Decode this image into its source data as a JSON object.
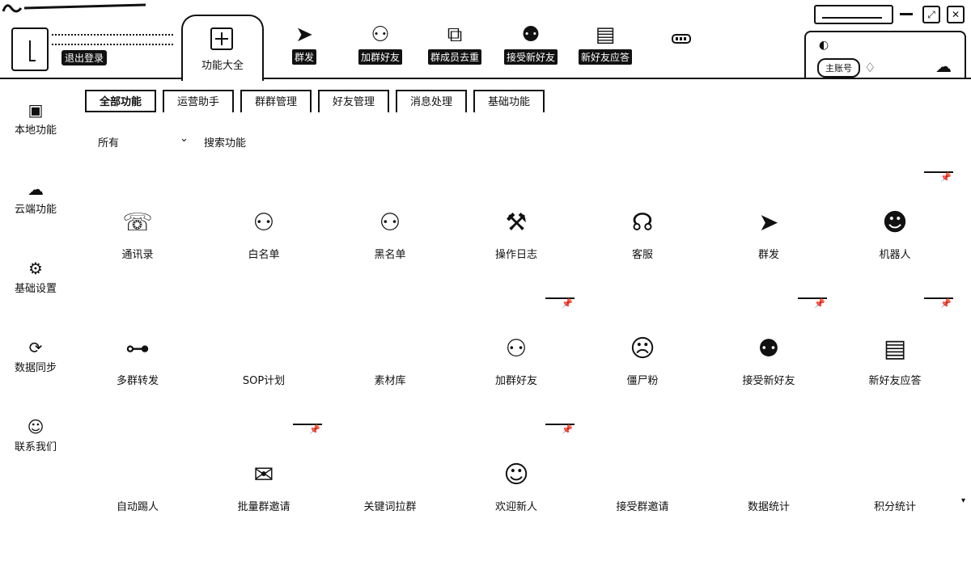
{
  "header": {
    "logout_label": "退出登录",
    "active_tab": {
      "label": "功能大全",
      "icon": "plus-square-icon"
    },
    "tabs": [
      {
        "label": "群发",
        "icon": "send-icon",
        "glyph": "➤"
      },
      {
        "label": "加群好友",
        "icon": "add-user-icon",
        "glyph": "⚇"
      },
      {
        "label": "群成员去重",
        "icon": "overlap-squares-icon",
        "glyph": "⧉"
      },
      {
        "label": "接受新好友",
        "icon": "users-icon",
        "glyph": "⚉"
      },
      {
        "label": "新好友应答",
        "icon": "chat-icon",
        "glyph": "▤"
      }
    ],
    "account_pill": "主账号",
    "window_controls": {
      "min": "—",
      "max": "⤢",
      "close": "✕"
    }
  },
  "sidebar": {
    "items": [
      {
        "label": "本地功能",
        "icon": "monitor-icon",
        "glyph": "▣"
      },
      {
        "label": "云端功能",
        "icon": "cloud-icon",
        "glyph": "☁"
      },
      {
        "label": "基础设置",
        "icon": "gear-icon",
        "glyph": "⚙"
      },
      {
        "label": "数据同步",
        "icon": "sync-data-icon",
        "glyph": "⟳"
      },
      {
        "label": "联系我们",
        "icon": "person-icon",
        "glyph": "☺"
      }
    ]
  },
  "category_tabs": [
    "全部功能",
    "运营助手",
    "群群管理",
    "好友管理",
    "消息处理",
    "基础功能"
  ],
  "filter": {
    "selected": "所有",
    "chevron": "⌄",
    "search_placeholder": "搜索功能"
  },
  "features": [
    {
      "label": "通讯录",
      "icon": "contacts-book-icon",
      "glyph": "☏",
      "pinned": false
    },
    {
      "label": "白名单",
      "icon": "whitelist-user-icon",
      "glyph": "⚇",
      "pinned": false
    },
    {
      "label": "黑名单",
      "icon": "blacklist-user-icon",
      "glyph": "⚇",
      "pinned": false
    },
    {
      "label": "操作日志",
      "icon": "log-icon",
      "glyph": "⚒",
      "pinned": false
    },
    {
      "label": "客服",
      "icon": "headset-icon",
      "glyph": "☊",
      "pinned": false
    },
    {
      "label": "群发",
      "icon": "send-icon",
      "glyph": "➤",
      "pinned": false
    },
    {
      "label": "机器人",
      "icon": "robot-icon",
      "glyph": "☻",
      "pinned": true
    },
    {
      "label": "多群转发",
      "icon": "hierarchy-icon",
      "glyph": "⊶",
      "pinned": false
    },
    {
      "label": "SOP计划",
      "icon": "",
      "glyph": "",
      "pinned": false
    },
    {
      "label": "素材库",
      "icon": "",
      "glyph": "",
      "pinned": false
    },
    {
      "label": "加群好友",
      "icon": "add-user-icon",
      "glyph": "⚇",
      "pinned": true
    },
    {
      "label": "僵尸粉",
      "icon": "zombie-face-icon",
      "glyph": "☹",
      "pinned": false
    },
    {
      "label": "接受新好友",
      "icon": "users-icon",
      "glyph": "⚉",
      "pinned": true
    },
    {
      "label": "新好友应答",
      "icon": "chat-icon",
      "glyph": "▤",
      "pinned": true
    },
    {
      "label": "自动踢人",
      "icon": "",
      "glyph": "",
      "pinned": false
    },
    {
      "label": "批量群邀请",
      "icon": "inbox-icon",
      "glyph": "✉",
      "pinned": true
    },
    {
      "label": "关键词拉群",
      "icon": "",
      "glyph": "",
      "pinned": false
    },
    {
      "label": "欢迎新人",
      "icon": "welcome-bubble-icon",
      "glyph": "☺",
      "pinned": true
    },
    {
      "label": "接受群邀请",
      "icon": "",
      "glyph": "",
      "pinned": false
    },
    {
      "label": "数据统计",
      "icon": "",
      "glyph": "",
      "pinned": false
    },
    {
      "label": "积分统计",
      "icon": "",
      "glyph": "",
      "pinned": false
    }
  ]
}
